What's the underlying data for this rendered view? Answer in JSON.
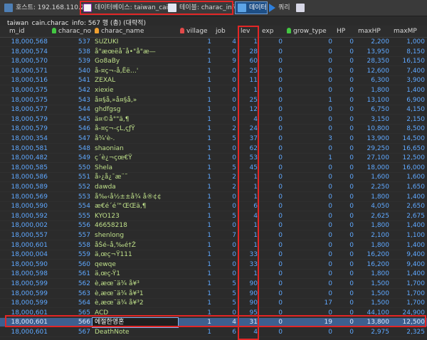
{
  "toolbar": {
    "host": "호스트: 192.168.110.2",
    "database": "데이터베이스: taiwan_cain",
    "table": "테이블: charac_info",
    "data_tab": "데이터",
    "query_tab": "쿼리"
  },
  "info": "taiwan_cain.charac_info: 567 행 (총) (대략적)",
  "columns": [
    "m_id",
    "charac_no",
    "charac_name",
    "village",
    "job",
    "lev",
    "exp",
    "grow_type",
    "HP",
    "maxHP",
    "maxMP"
  ],
  "rows": [
    [
      "18,000,568",
      "537",
      "SUZUKI",
      "1",
      "4",
      "1",
      "0",
      "0",
      "0",
      "2,200",
      "1,000"
    ],
    [
      "18,000,574",
      "538",
      "å\"æœëå¨å•\"å\"æ—",
      "1",
      "0",
      "28",
      "0",
      "0",
      "0",
      "13,950",
      "8,150"
    ],
    [
      "18,000,570",
      "539",
      "Go8aBy",
      "1",
      "9",
      "60",
      "0",
      "0",
      "0",
      "28,350",
      "16,150"
    ],
    [
      "18,000,571",
      "540",
      "å-¤ç¬-å,Ëë…'",
      "1",
      "0",
      "25",
      "0",
      "0",
      "0",
      "12,600",
      "7,400"
    ],
    [
      "18,000,516",
      "541",
      "ZEXAL",
      "1",
      "0",
      "11",
      "0",
      "0",
      "0",
      "6,300",
      "3,900"
    ],
    [
      "18,000,575",
      "542",
      "xiexie",
      "1",
      "0",
      "1",
      "0",
      "0",
      "0",
      "1,800",
      "1,400"
    ],
    [
      "18,000,575",
      "543",
      "å¤§å,»å¤§å,»",
      "1",
      "0",
      "25",
      "0",
      "1",
      "0",
      "13,100",
      "6,900"
    ],
    [
      "18,000,577",
      "544",
      "ghdfgsg",
      "1",
      "0",
      "12",
      "0",
      "0",
      "0",
      "6,750",
      "4,150"
    ],
    [
      "18,000,579",
      "545",
      "ä¤©å°\"ä,¶",
      "1",
      "0",
      "4",
      "0",
      "0",
      "0",
      "3,150",
      "2,150"
    ],
    [
      "18,000,579",
      "546",
      "å-¤ç¬-çL,çƒŸ",
      "1",
      "2",
      "24",
      "0",
      "0",
      "0",
      "10,800",
      "8,500"
    ],
    [
      "18,000,354",
      "547",
      "å¾'è-.",
      "1",
      "5",
      "37",
      "0",
      "3",
      "0",
      "13,900",
      "14,500"
    ],
    [
      "18,000,581",
      "548",
      "shaonian",
      "1",
      "0",
      "62",
      "0",
      "0",
      "0",
      "29,250",
      "16,650"
    ],
    [
      "18,000,482",
      "549",
      "ç´è¿¬çœ€Ÿ",
      "1",
      "0",
      "53",
      "0",
      "1",
      "0",
      "27,100",
      "12,500"
    ],
    [
      "18,000,585",
      "550",
      "Shela",
      "1",
      "5",
      "45",
      "0",
      "0",
      "0",
      "18,000",
      "16,000"
    ],
    [
      "18,000,586",
      "551",
      "å›¿å¿¯æ¨˜",
      "1",
      "2",
      "1",
      "0",
      "0",
      "0",
      "1,600",
      "1,600"
    ],
    [
      "18,000,589",
      "552",
      "dawda",
      "1",
      "2",
      "1",
      "0",
      "0",
      "0",
      "2,250",
      "1,650"
    ],
    [
      "18,000,569",
      "553",
      "å‰‹å½±±å¾ å®¢¢",
      "1",
      "0",
      "1",
      "0",
      "0",
      "0",
      "1,800",
      "1,400"
    ],
    [
      "18,000,590",
      "554",
      "æ€é´é™ŒŒä,¶",
      "1",
      "0",
      "6",
      "0",
      "0",
      "0",
      "4,050",
      "2,650"
    ],
    [
      "18,000,592",
      "555",
      "KYO123",
      "1",
      "5",
      "4",
      "0",
      "0",
      "0",
      "2,625",
      "2,675"
    ],
    [
      "18,000,002",
      "556",
      "46658218",
      "1",
      "0",
      "1",
      "0",
      "0",
      "0",
      "1,800",
      "1,400"
    ],
    [
      "18,000,557",
      "557",
      "shenlong",
      "1",
      "7",
      "1",
      "0",
      "0",
      "0",
      "2,100",
      "1,100"
    ],
    [
      "18,000,601",
      "558",
      "åŠé–å‚‰é†Ž",
      "1",
      "0",
      "1",
      "0",
      "0",
      "0",
      "1,800",
      "1,400"
    ],
    [
      "18,000,004",
      "559",
      "ä,œç¬Ÿ111",
      "1",
      "0",
      "33",
      "0",
      "0",
      "0",
      "16,200",
      "9,400"
    ],
    [
      "18,000,590",
      "560",
      "qewqe",
      "1",
      "0",
      "33",
      "0",
      "0",
      "0",
      "16,200",
      "9,400"
    ],
    [
      "18,000,598",
      "561",
      "ä,œç-Ÿ1",
      "1",
      "0",
      "1",
      "0",
      "0",
      "0",
      "1,800",
      "1,400"
    ],
    [
      "18,000,599",
      "562",
      "è,æœ¨ä¾ å¥³",
      "1",
      "5",
      "90",
      "0",
      "0",
      "0",
      "1,500",
      "1,700"
    ],
    [
      "18,000,599",
      "563",
      "è,æœ¨ä¾ å¥³1",
      "1",
      "5",
      "90",
      "0",
      "0",
      "0",
      "1,500",
      "1,700"
    ],
    [
      "18,000,599",
      "564",
      "è,æœ¨ä¾ å¥³2",
      "1",
      "5",
      "90",
      "0",
      "17",
      "0",
      "1,500",
      "1,700"
    ],
    [
      "18,000,601",
      "565",
      "ACD",
      "1",
      "0",
      "95",
      "0",
      "0",
      "0",
      "44,100",
      "24,900"
    ],
    [
      "18,000,601",
      "566",
      "에절한영혼",
      "1",
      "4",
      "31",
      "0",
      "19",
      "0",
      "13,800",
      "12,500"
    ],
    [
      "18,000,601",
      "567",
      "DeathNote",
      "1",
      "6",
      "4",
      "0",
      "0",
      "0",
      "2,975",
      "2,325"
    ]
  ],
  "selected_row_index": 29,
  "colors": {
    "red_highlight": "#e22626",
    "number_text": "#5fa8ff",
    "text_value": "#bfe08a",
    "selected_row": "#3d5f8f"
  },
  "icons": {
    "host": "server-icon",
    "database": "database-icon",
    "table": "table-icon",
    "data": "grid-icon",
    "query": "play-icon"
  }
}
